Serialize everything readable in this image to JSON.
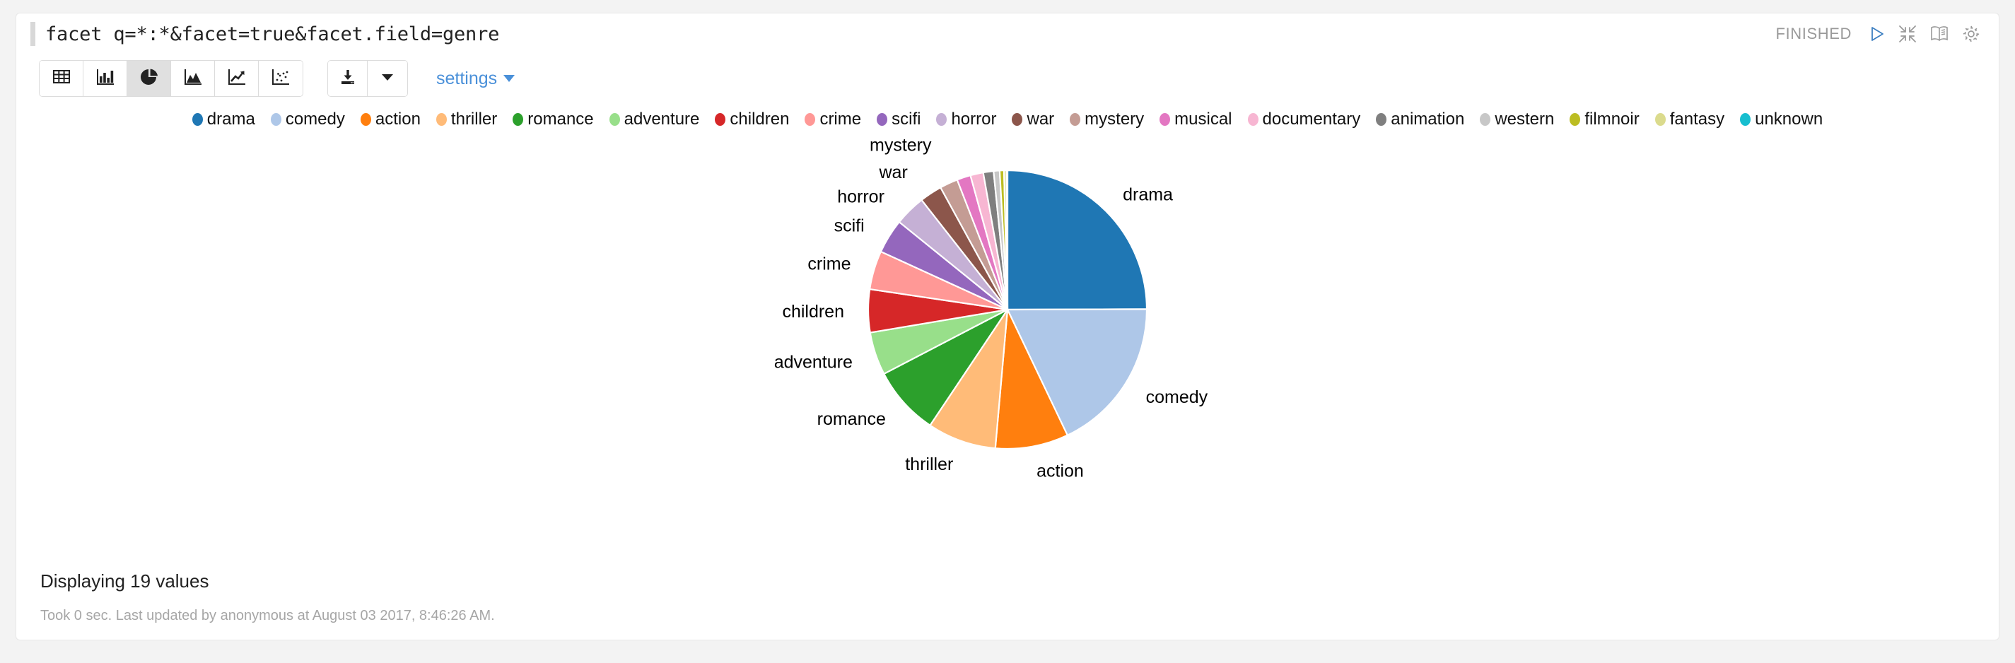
{
  "editor": {
    "code": "facet q=*:*&facet=true&facet.field=genre"
  },
  "header": {
    "status": "FINISHED",
    "icons": {
      "run": "play-icon",
      "collapse": "minimize-icon",
      "book": "book-icon",
      "gear": "gear-icon"
    }
  },
  "toolbar": {
    "viz_buttons": [
      {
        "name": "table-view-button",
        "icon": "table-icon",
        "active": false
      },
      {
        "name": "bar-chart-button",
        "icon": "bar-chart-icon",
        "active": false
      },
      {
        "name": "pie-chart-button",
        "icon": "pie-chart-icon",
        "active": true
      },
      {
        "name": "area-chart-button",
        "icon": "area-chart-icon",
        "active": false
      },
      {
        "name": "line-chart-button",
        "icon": "line-chart-icon",
        "active": false
      },
      {
        "name": "scatter-chart-button",
        "icon": "scatter-chart-icon",
        "active": false
      }
    ],
    "download_icon": "download-icon",
    "download_caret_icon": "chevron-down-icon",
    "settings_label": "settings",
    "settings_caret_icon": "chevron-down-icon"
  },
  "footer": {
    "displaying": "Displaying 19 values",
    "meta": "Took 0 sec. Last updated by anonymous at August 03 2017, 8:46:26 AM."
  },
  "chart_data": {
    "type": "pie",
    "title": "",
    "legend_position": "top",
    "total_values": 19,
    "categories": [
      "drama",
      "comedy",
      "action",
      "thriller",
      "romance",
      "adventure",
      "children",
      "crime",
      "scifi",
      "horror",
      "war",
      "mystery",
      "musical",
      "documentary",
      "animation",
      "western",
      "filmnoir",
      "fantasy",
      "unknown"
    ],
    "values": [
      25.0,
      18.0,
      8.5,
      8.0,
      8.0,
      5.0,
      5.0,
      4.5,
      4.0,
      3.6,
      2.6,
      2.1,
      1.6,
      1.5,
      1.2,
      0.7,
      0.5,
      0.3,
      0.1
    ],
    "unit": "percent",
    "colors": [
      "#1f77b4",
      "#aec7e8",
      "#ff7f0e",
      "#ffbb78",
      "#2ca02c",
      "#98df8a",
      "#d62728",
      "#ff9896",
      "#9467bd",
      "#c5b0d5",
      "#8c564b",
      "#c49c94",
      "#e377c2",
      "#f7b6d2",
      "#7f7f7f",
      "#c7c7c7",
      "#bcbd22",
      "#dbdb8d",
      "#17becf"
    ],
    "labeled_slices": [
      "drama",
      "comedy",
      "action",
      "thriller",
      "romance",
      "adventure",
      "children",
      "crime",
      "scifi",
      "horror",
      "war",
      "mystery"
    ]
  }
}
